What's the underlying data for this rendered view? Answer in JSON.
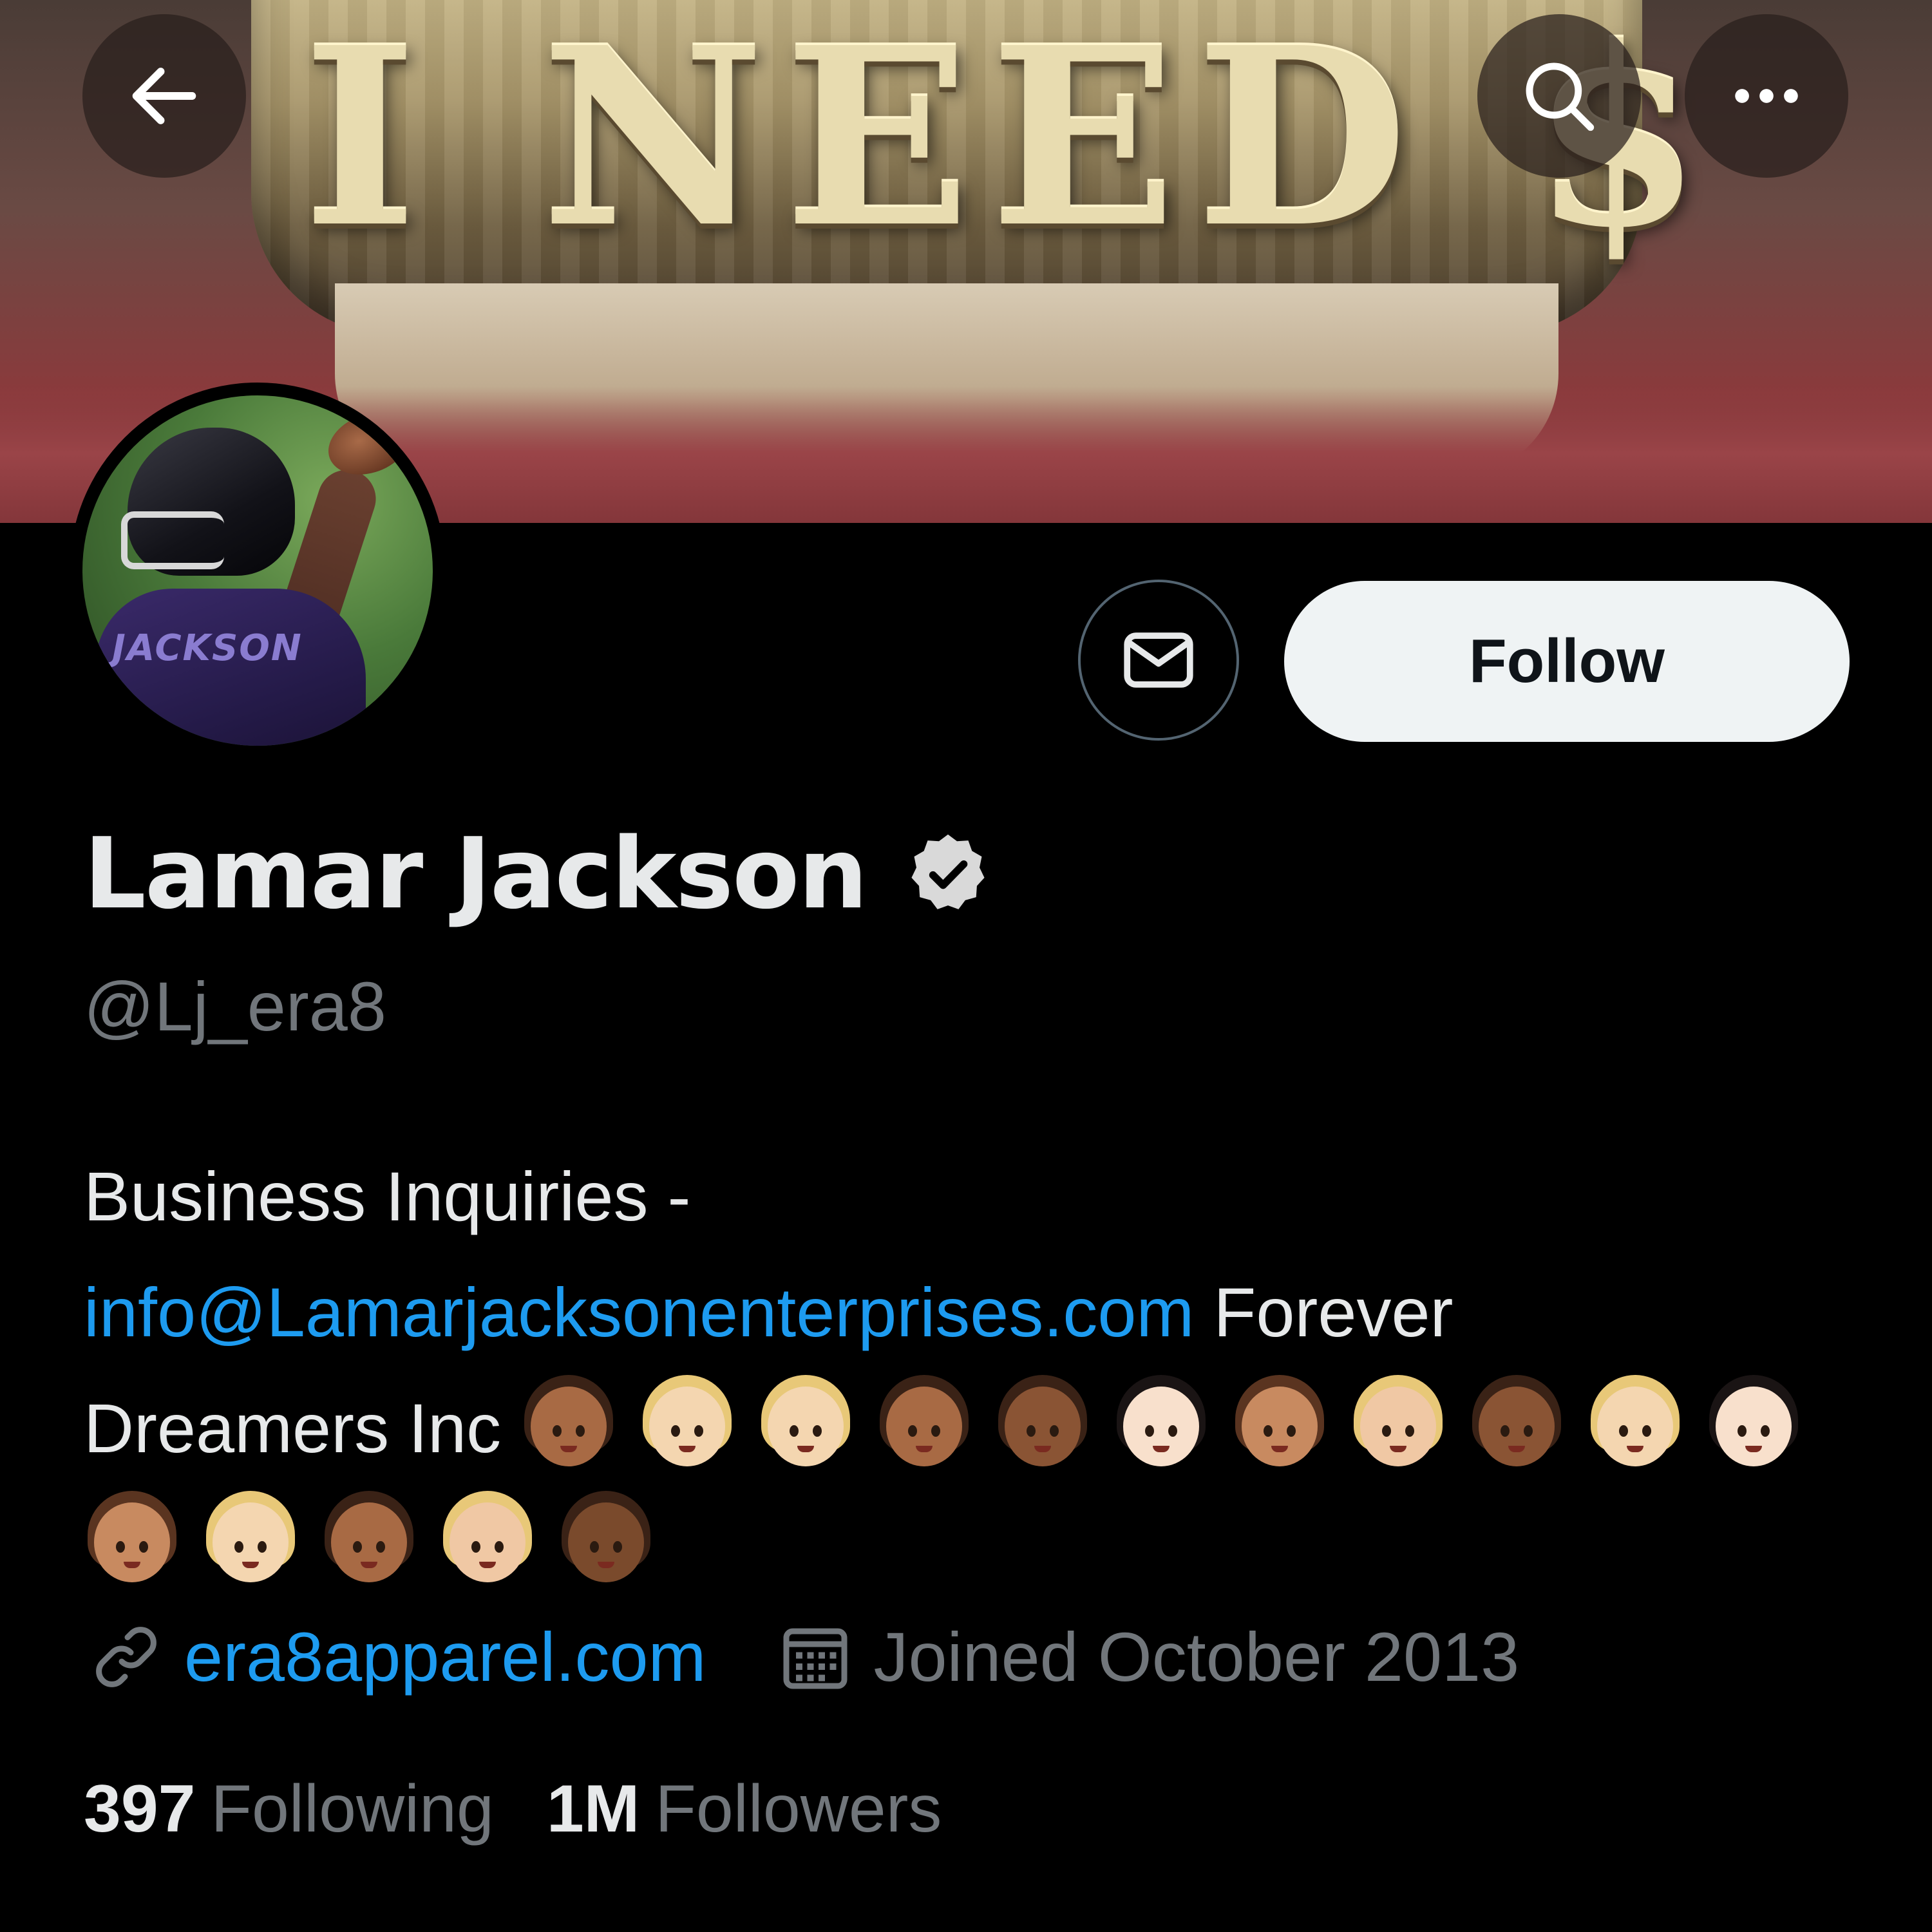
{
  "banner": {
    "grill_text": "I NEED $"
  },
  "nav": {
    "back_icon": "arrow-left-icon",
    "search_icon": "search-icon",
    "more_icon": "more-horizontal-icon"
  },
  "avatar": {
    "jersey_name": "JACKSON"
  },
  "actions": {
    "message_icon": "envelope-icon",
    "follow_label": "Follow"
  },
  "profile": {
    "name": "Lamar Jackson",
    "verified_icon": "verified-badge-icon",
    "handle": "@Lj_era8"
  },
  "bio": {
    "line1": "Business Inquiries -",
    "email": "info@Lamarjacksonenterprises.com",
    "text_after_email": " Forever",
    "text_line3": "Dreamers Inc",
    "emojis": [
      {
        "hair": "#3a2216",
        "skin": "#a86a44"
      },
      {
        "hair": "#e8c878",
        "skin": "#f4d6b0"
      },
      {
        "hair": "#e8c878",
        "skin": "#f4d6b0"
      },
      {
        "hair": "#3a2216",
        "skin": "#a86a44"
      },
      {
        "hair": "#3a2216",
        "skin": "#8a5434"
      },
      {
        "hair": "#1a1414",
        "skin": "#f8e0cc"
      },
      {
        "hair": "#5a3420",
        "skin": "#c88a60"
      },
      {
        "hair": "#e8c878",
        "skin": "#f0c8a4"
      },
      {
        "hair": "#3a2216",
        "skin": "#8a5434"
      },
      {
        "hair": "#e8c878",
        "skin": "#f4d6b0"
      },
      {
        "hair": "#1a1414",
        "skin": "#f8e0cc"
      },
      {
        "hair": "#5a3420",
        "skin": "#c88a60"
      },
      {
        "hair": "#e8c878",
        "skin": "#f4d6b0"
      },
      {
        "hair": "#3a2216",
        "skin": "#a86a44"
      },
      {
        "hair": "#e8c878",
        "skin": "#f0c8a4"
      },
      {
        "hair": "#3a2216",
        "skin": "#7a4a2c"
      }
    ]
  },
  "meta": {
    "link_icon": "link-icon",
    "website": "era8apparel.com",
    "calendar_icon": "calendar-icon",
    "joined": "Joined October 2013"
  },
  "counts": {
    "following_count": "397",
    "following_label": "Following",
    "followers_count": "1M",
    "followers_label": "Followers"
  },
  "colors": {
    "background": "#000000",
    "primary_text": "#e7e9ea",
    "secondary_text": "#71767b",
    "link": "#1d9bf0",
    "follow_bg": "#eff3f4"
  }
}
